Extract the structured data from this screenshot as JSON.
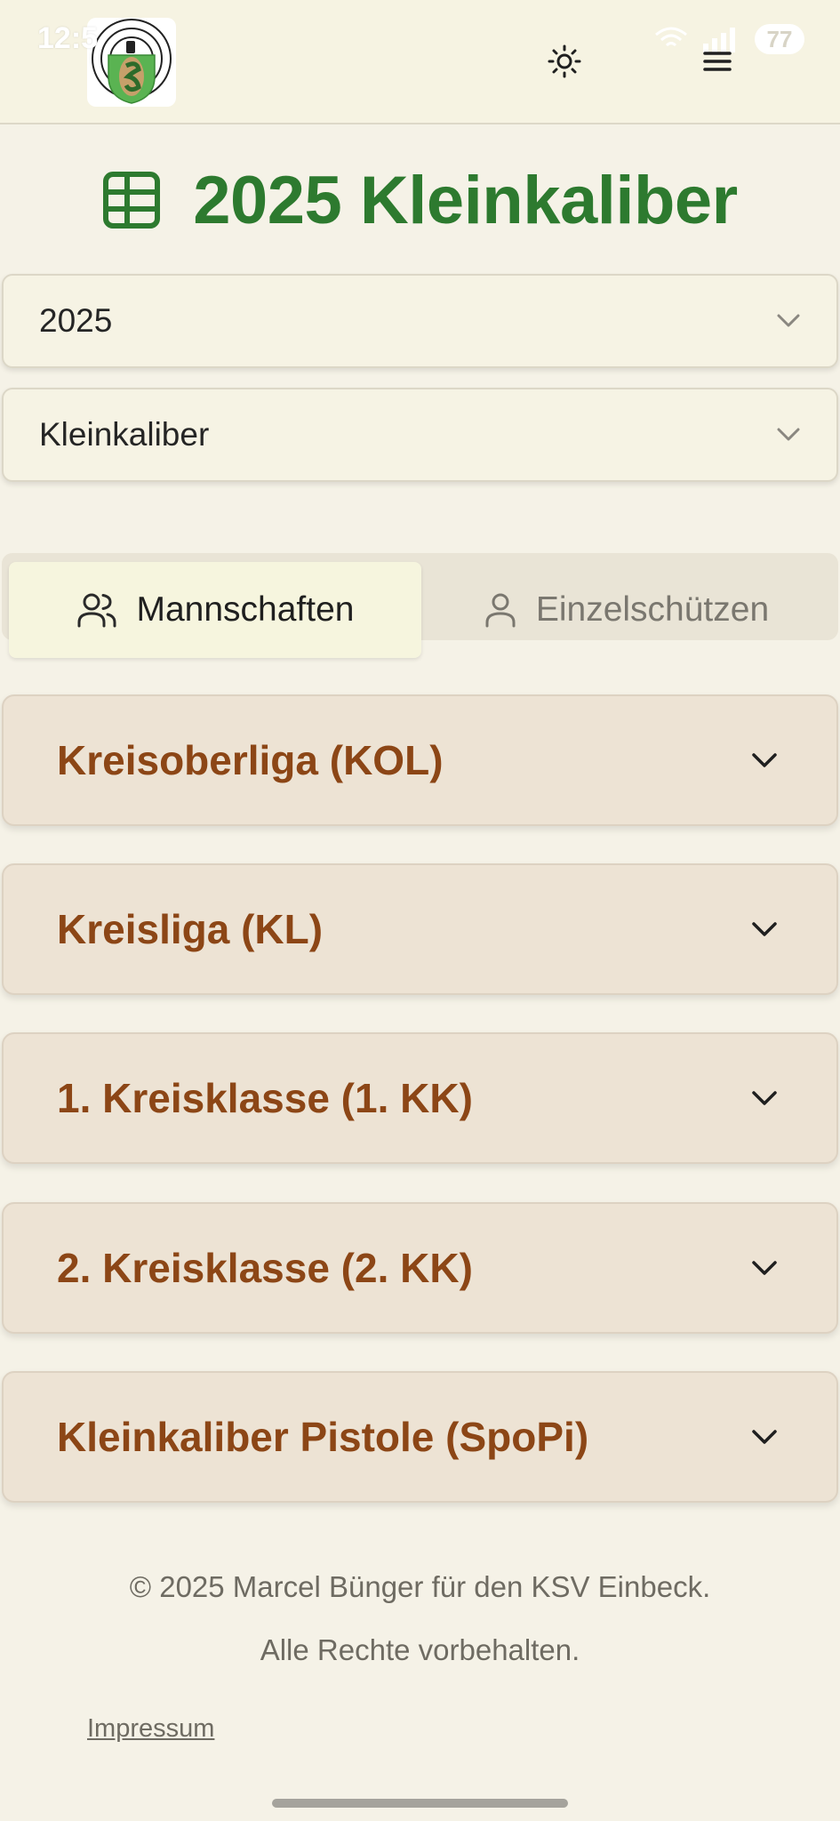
{
  "status_bar": {
    "time": "12:5",
    "battery": "77"
  },
  "header": {
    "logo_alt": "KSV Einbeck"
  },
  "page": {
    "title": "2025 Kleinkaliber"
  },
  "filters": {
    "year": {
      "value": "2025"
    },
    "discipline": {
      "value": "Kleinkaliber"
    }
  },
  "tabs": [
    {
      "label": "Mannschaften",
      "active": true
    },
    {
      "label": "Einzelschützen",
      "active": false
    }
  ],
  "leagues": [
    {
      "label": "Kreisoberliga (KOL)"
    },
    {
      "label": "Kreisliga (KL)"
    },
    {
      "label": "1. Kreisklasse (1. KK)"
    },
    {
      "label": "2. Kreisklasse (2. KK)"
    },
    {
      "label": "Kleinkaliber Pistole (SpoPi)"
    }
  ],
  "footer": {
    "copyright": "© 2025 Marcel Bünger für den KSV Einbeck.",
    "rights": "Alle Rechte vorbehalten.",
    "impressum": "Impressum"
  },
  "colors": {
    "accent_green": "#2d7a2f",
    "league_text": "#8c4616",
    "background": "#f5f2e7"
  }
}
